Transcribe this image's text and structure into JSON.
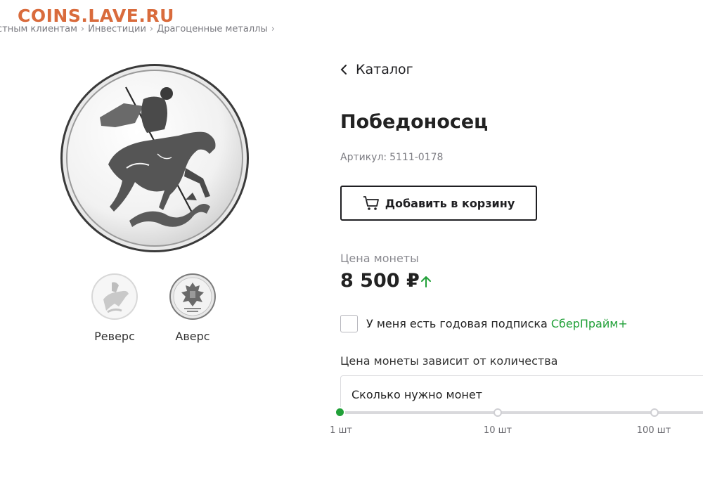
{
  "watermark": "COINS.LAVE.RU",
  "breadcrumb": [
    "стным клиентам",
    "Инвестиции",
    "Драгоценные металлы"
  ],
  "gallery": {
    "thumbs": [
      {
        "label": "Реверс"
      },
      {
        "label": "Аверс"
      }
    ]
  },
  "product": {
    "back_label": "Каталог",
    "title": "Победоносец",
    "article_label": "Артикул:",
    "article_value": "5111-0178",
    "cart_button": "Добавить в корзину",
    "price_label": "Цена монеты",
    "price_value": "8 500 ₽",
    "price_trend": "up",
    "subscription_text": "У меня есть годовая подписка",
    "subscription_brand": "СберПрайм+",
    "qty_caption": "Цена монеты зависит от количества",
    "qty_placeholder": "Сколько нужно монет",
    "qty_ticks": [
      "1 шт",
      "10 шт",
      "100 шт"
    ],
    "qty_selected": "1 шт"
  },
  "colors": {
    "accent_green": "#21a038",
    "watermark": "#d96b3c",
    "text_dark": "#1f1f22",
    "text_muted": "#7c7c82"
  },
  "icons": {
    "back": "chevron-left-icon",
    "cart": "cart-icon",
    "trend": "arrow-up-icon"
  }
}
